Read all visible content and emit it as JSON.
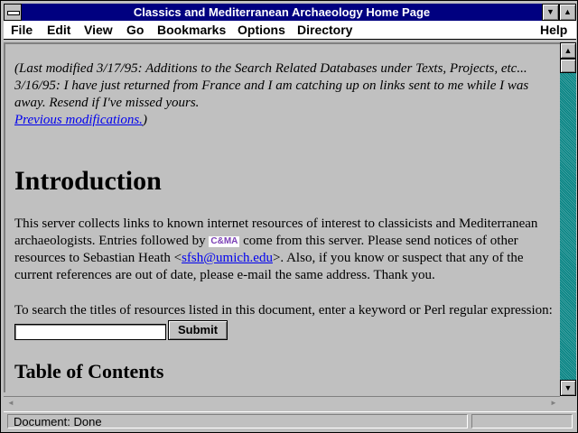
{
  "window": {
    "title": "Classics and Mediterranean Archaeology Home Page",
    "min_glyph": "▼",
    "max_glyph": "▲"
  },
  "menu": {
    "file": "File",
    "edit": "Edit",
    "view": "View",
    "go": "Go",
    "bookmarks": "Bookmarks",
    "options": "Options",
    "directory": "Directory",
    "help": "Help"
  },
  "page": {
    "notice_line1": "(Last modified 3/17/95: Additions to the Search Related Databases under Texts, Projects, etc...",
    "notice_line2": "3/16/95: I have just returned from France and I am catching up on links sent to me while I was away. Resend if I've missed yours.",
    "previous_link": "Previous modifications.",
    "notice_close": ")",
    "heading_intro": "Introduction",
    "intro_part1": "This server collects links to known internet resources of interest to classicists and Mediterranean archaeologists. Entries followed by ",
    "cma_badge": "C&MA",
    "intro_part2": " come from this server. Please send notices of other resources to Sebastian Heath <",
    "email_link": "sfsh@umich.edu",
    "intro_part3": ">. Also, if you know or suspect that any of the current references are out of date, please e-mail the same address. Thank you.",
    "search_label": "To search the titles of resources listed in this document, enter a keyword or Perl regular expression:",
    "search_value": "",
    "submit_label": "Submit",
    "heading_toc": "Table of Contents"
  },
  "scroll": {
    "up": "▲",
    "down": "▼",
    "left": "◄",
    "right": "►"
  },
  "status": {
    "text": "Document: Done"
  }
}
